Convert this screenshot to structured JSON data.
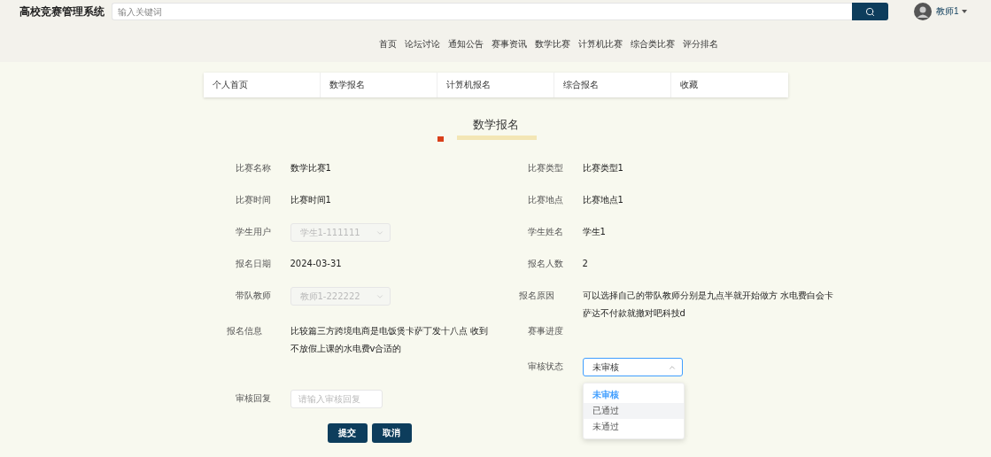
{
  "site_title": "高校竞赛管理系统",
  "search": {
    "placeholder": "输入关键词"
  },
  "user": {
    "name": "教师1"
  },
  "nav": [
    "首页",
    "论坛讨论",
    "通知公告",
    "赛事资讯",
    "数学比赛",
    "计算机比赛",
    "综合类比赛",
    "评分排名"
  ],
  "tabs": [
    "个人首页",
    "数学报名",
    "计算机报名",
    "综合报名",
    "收藏"
  ],
  "heading": "数学报名",
  "rows": [
    {
      "left": {
        "kind": "text",
        "label": "比赛名称",
        "value": "数学比赛1"
      },
      "right": {
        "kind": "text",
        "label": "比赛类型",
        "value": "比赛类型1"
      }
    },
    {
      "left": {
        "kind": "text",
        "label": "比赛时间",
        "value": "比赛时间1"
      },
      "right": {
        "kind": "text",
        "label": "比赛地点",
        "value": "比赛地点1"
      }
    },
    {
      "left": {
        "kind": "select",
        "label": "学生用户",
        "value": "学生1-111111",
        "disabled": true
      },
      "right": {
        "kind": "text",
        "label": "学生姓名",
        "value": "学生1"
      }
    },
    {
      "left": {
        "kind": "text",
        "label": "报名日期",
        "value": "2024-03-31"
      },
      "right": {
        "kind": "text",
        "label": "报名人数",
        "value": "2"
      }
    },
    {
      "left": {
        "kind": "select",
        "label": "带队教师",
        "value": "教师1-222222",
        "disabled": true
      },
      "right": {
        "kind": "long",
        "label": "报名原因",
        "value": "可以选择自己的带队教师分别是九点半就开始做方 水电费白会卡萨达不付款就撤对吧科技d"
      }
    },
    {
      "left": {
        "kind": "long",
        "label": "报名信息",
        "value": "比较篇三方跨境电商是电饭煲卡萨丁发十八点 收到不放假上课的水电费v合适的"
      },
      "right": {
        "kind": "label",
        "label": "赛事进度"
      }
    },
    {
      "left": {
        "kind": "none"
      },
      "right": {
        "kind": "open-select",
        "label": "审核状态",
        "value": "未审核",
        "disabled": false,
        "options": [
          {
            "label": "未审核",
            "selected": true,
            "hovered": false
          },
          {
            "label": "已通过",
            "selected": false,
            "hovered": true
          },
          {
            "label": "未通过",
            "selected": false,
            "hovered": false
          }
        ]
      }
    }
  ],
  "review_reply": {
    "kind": "input",
    "label": "审核回复",
    "placeholder": "请输入审核回复"
  },
  "buttons": [
    "提交",
    "取消"
  ]
}
